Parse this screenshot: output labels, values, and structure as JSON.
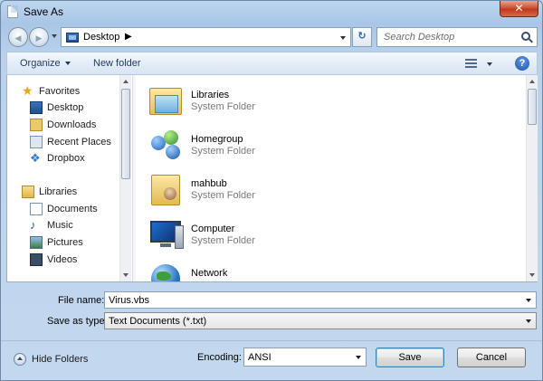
{
  "window": {
    "title": "Save As",
    "close_label": "✕"
  },
  "nav": {
    "back_glyph": "◀",
    "forward_glyph": "▶",
    "address_location": "Desktop",
    "address_chevron": "▶",
    "refresh_glyph": "↻",
    "search_placeholder": "Search Desktop"
  },
  "toolbar": {
    "organize_label": "Organize",
    "new_folder_label": "New folder",
    "help_glyph": "?"
  },
  "sidebar": {
    "items": [
      {
        "label": "Favorites",
        "icon": "star-icon",
        "level": "group"
      },
      {
        "label": "Desktop",
        "icon": "desktop-icon",
        "level": "child"
      },
      {
        "label": "Downloads",
        "icon": "downloads-icon",
        "level": "child"
      },
      {
        "label": "Recent Places",
        "icon": "recent-places-icon",
        "level": "child"
      },
      {
        "label": "Dropbox",
        "icon": "dropbox-icon",
        "level": "child"
      },
      {
        "label": "Libraries",
        "icon": "libraries-icon",
        "level": "group"
      },
      {
        "label": "Documents",
        "icon": "documents-icon",
        "level": "child"
      },
      {
        "label": "Music",
        "icon": "music-icon",
        "level": "child"
      },
      {
        "label": "Pictures",
        "icon": "pictures-icon",
        "level": "child"
      },
      {
        "label": "Videos",
        "icon": "videos-icon",
        "level": "child"
      }
    ],
    "glyphs": {
      "star": "★",
      "dropbox": "❖",
      "music": "♪"
    }
  },
  "files": [
    {
      "name": "Libraries",
      "type": "System Folder",
      "icon": "libraries-folder-icon"
    },
    {
      "name": "Homegroup",
      "type": "System Folder",
      "icon": "homegroup-icon"
    },
    {
      "name": "mahbub",
      "type": "System Folder",
      "icon": "user-folder-icon"
    },
    {
      "name": "Computer",
      "type": "System Folder",
      "icon": "computer-icon"
    },
    {
      "name": "Network",
      "type": "",
      "icon": "network-icon"
    }
  ],
  "form": {
    "file_name_label": "File name:",
    "file_name_value": "Virus.vbs",
    "save_as_type_label": "Save as type:",
    "save_as_type_value": "Text Documents (*.txt)",
    "encoding_label": "Encoding:",
    "encoding_value": "ANSI"
  },
  "footer": {
    "hide_folders_label": "Hide Folders",
    "save_label": "Save",
    "cancel_label": "Cancel"
  }
}
